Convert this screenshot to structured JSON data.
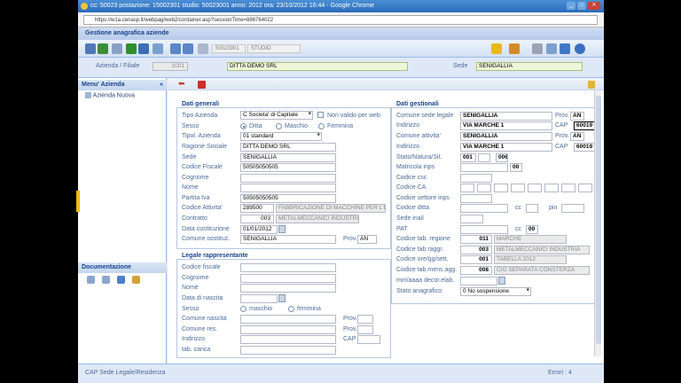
{
  "browser": {
    "title": "cc: 50023 postazione: 15002301 studio: 50023001 anno: 2012 ora: 23/10/2012 16:44 - Google Chrome",
    "url": "https://w1a.cenasp.it/webpag/web2/container.asp?sessionTime=886764022"
  },
  "app": {
    "header": "Gestione anagrafica aziende",
    "toolbar_code": "50023001",
    "toolbar_name": "STUDIO"
  },
  "filter": {
    "azienda_label": "Azienda / Filiale",
    "azienda_code": "1001",
    "azienda_name": "DITTA DEMO SRL",
    "sede_label": "Sede",
    "sede_value": "SENIGALLIA"
  },
  "sidebar": {
    "menu_title": "Menu' Azienda",
    "item": "Azienda Nuova",
    "doc_title": "Documentazione"
  },
  "generali": {
    "title": "Dati generali",
    "tipo_azienda_label": "Tipo Azienda",
    "tipo_azienda": "C Societa' di Capitale",
    "non_valido": "Non valido per web",
    "sesso_label": "Sesso",
    "ditta": "Ditta",
    "maschio": "Maschio",
    "femmina": "Femmina",
    "tipol_label": "Tipol. Azienda",
    "tipol": "01 standard",
    "ragione_label": "Ragione Sociale",
    "ragione": "DITTA DEMO SRL",
    "sede_label": "Sede",
    "sede": "SENIGALLIA",
    "cf_label": "Codice Fiscale",
    "cf": "50505050505",
    "cognome_label": "Cognome",
    "nome_label": "Nome",
    "piva_label": "Partita Iva",
    "piva": "50505050505",
    "attivita_label": "Codice Attivita'",
    "attivita_code": "289500",
    "attivita_desc": "FABBRICAZIONE DI MACCHINE PER L'IN",
    "contratto_label": "Contratto",
    "contratto_code": "003",
    "contratto_desc": "METALMECCANICI INDUSTRIA",
    "data_cost_label": "Data costituzione",
    "data_cost": "01/01/2012",
    "comune_cost_label": "Comune costituz.",
    "comune_cost": "SENIGALLIA",
    "prov_label": "Prov.",
    "prov": "AN"
  },
  "legale": {
    "title": "Legale rappresentante",
    "cf": "Codice fiscale",
    "cognome": "Cognome",
    "nome": "Nome",
    "data_nascita": "Data di nascita",
    "sesso": "Sesso",
    "maschio": "maschio",
    "femmina": "femmina",
    "comune_nascita": "Comune nascita",
    "comune_res": "Comune res.",
    "indirizzo": "Indirizzo",
    "carica": "tab. carica",
    "prov": "Prov.",
    "cap": "CAP"
  },
  "gestionali": {
    "title": "Dati gestionali",
    "comune_sede_label": "Comune sede legale",
    "comune_sede": "SENIGALLIA",
    "prov_label": "Prov.",
    "prov1": "AN",
    "indirizzo_label": "Indirizzo",
    "indirizzo1": "VIA MARCHE 1",
    "cap_label": "CAP",
    "cap1": "60019",
    "comune_att_label": "Comune attivita'",
    "comune_att": "SENIGALLIA",
    "prov2": "AN",
    "indirizzo2": "VIA MARCHE 1",
    "cap2": "60019",
    "stato_label": "Stato/Natura/Sit.",
    "stato1": "001",
    "stato2": "006",
    "matricola_label": "Matricola inps",
    "matricola": "00",
    "csc_label": "Codice csc",
    "ca_label": "Codice CA",
    "settore_label": "Codice settore inps",
    "ditta_label": "Codice ditta",
    "cc_label": "cc",
    "pin_label": "pin",
    "sede_inail_label": "Sede inail",
    "pat_label": "PAT",
    "pat_cc": "00",
    "regione_label": "Codice tab. regione",
    "regione_code": "011",
    "regione_desc": "MARCHE",
    "raggr_label": "Codice tab.raggr.",
    "raggr_code": "003",
    "raggr_desc": "METALMECCANICI INDUSTRIA",
    "ore_label": "Codice ore/gg/sett.",
    "ore_code": "001",
    "ore_desc": "TABELLA 2012",
    "mens_label": "Codice tab.mens.agg.",
    "mens_code": "008",
    "mens_desc": "CIG SEPARATA CONSTERZA",
    "decor_label": "mm/aaaa decor.elab.",
    "stato_anag_label": "Stato anagrafico",
    "stato_anag": "0 No sospensione"
  },
  "status": {
    "left": "CAP Sede Legale/Residenza",
    "errors": "Errori : 4"
  }
}
